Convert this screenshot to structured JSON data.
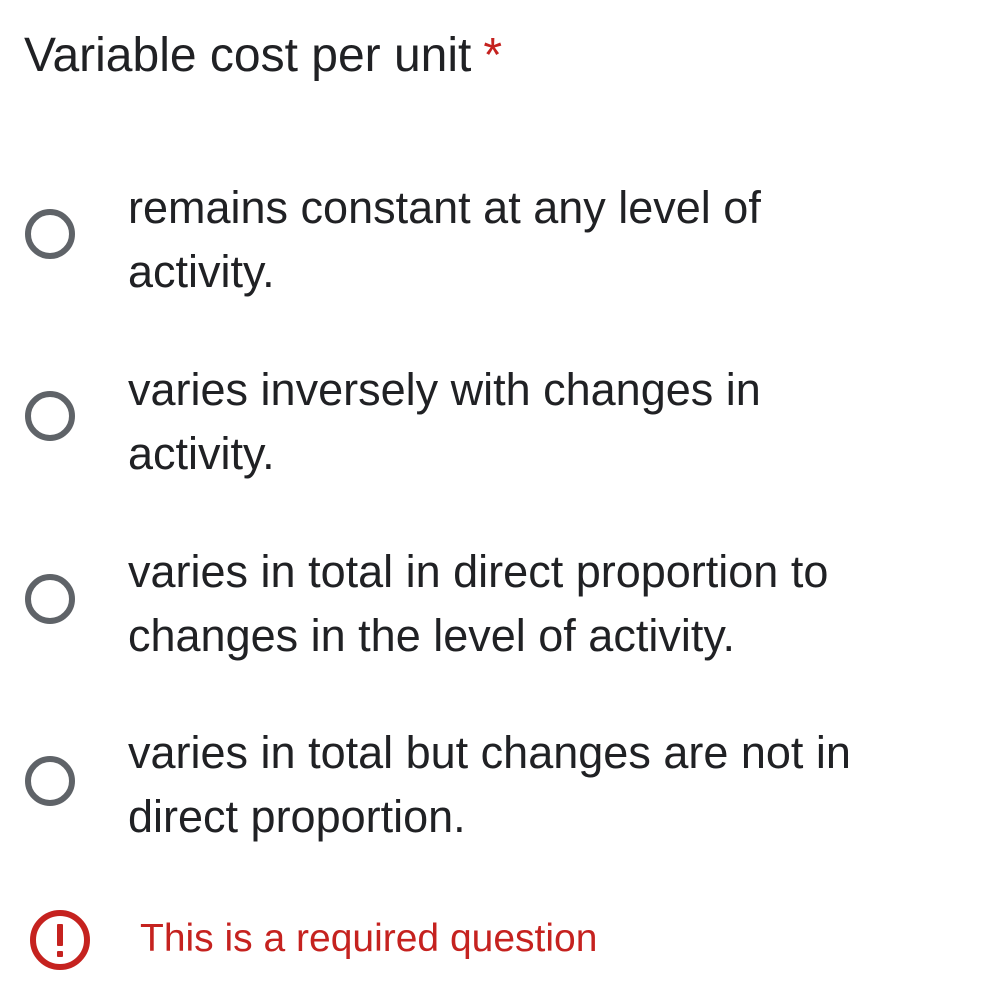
{
  "question": {
    "title": "Variable cost per unit",
    "required_marker": "*",
    "options": [
      {
        "line1": "remains constant at any level of",
        "line2": "activity."
      },
      {
        "line1": "varies inversely with changes in",
        "line2": "activity."
      },
      {
        "line1": "varies in total in direct proportion to",
        "line2": "changes in the level of activity."
      },
      {
        "line1": "varies in total but changes are not in",
        "line2": "direct proportion."
      }
    ],
    "error_message": "This is a required question",
    "selected_index": null
  },
  "colors": {
    "text": "#202124",
    "radio_border": "#5f6368",
    "error": "#c5221f"
  },
  "icons": {
    "radio": "radio-unchecked-icon",
    "error": "error-exclamation-icon"
  }
}
